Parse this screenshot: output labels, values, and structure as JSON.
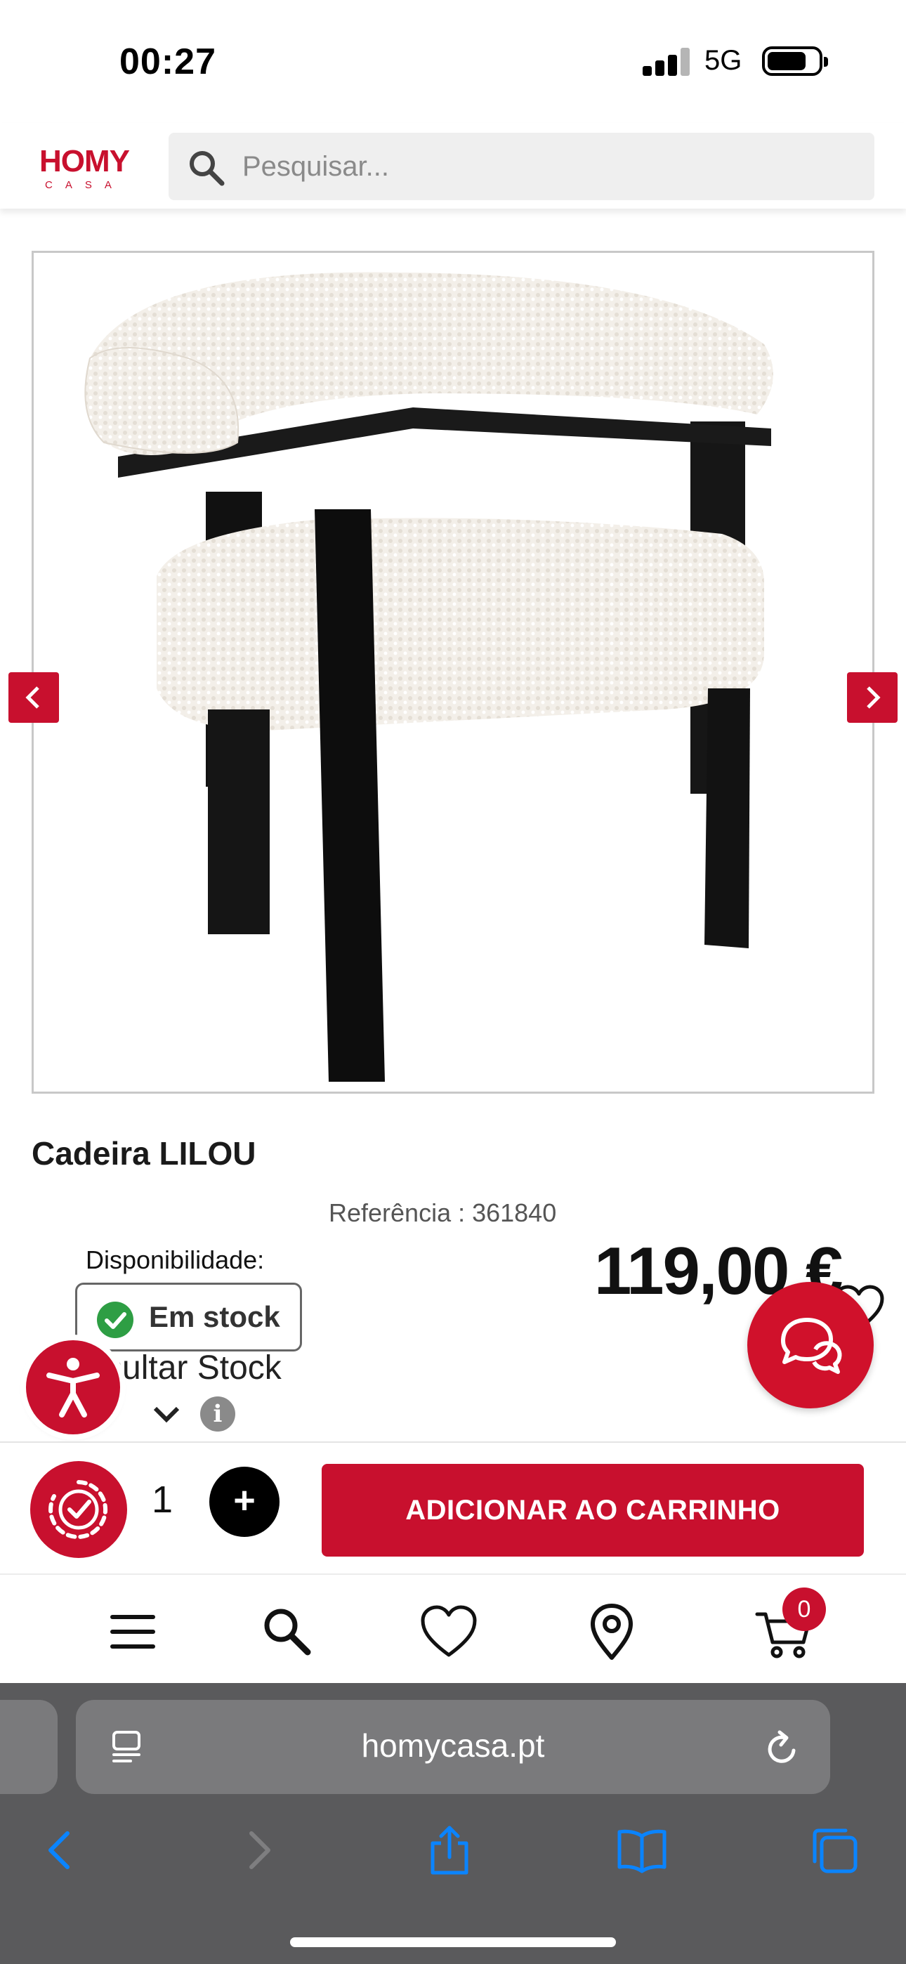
{
  "status_bar": {
    "time": "00:27",
    "network": "5G"
  },
  "header": {
    "logo_main": "HOMY",
    "logo_sub": "CASA",
    "search_placeholder": "Pesquisar..."
  },
  "product": {
    "title": "Cadeira LILOU",
    "reference": "Referência : 361840",
    "availability_label": "Disponibilidade:",
    "stock_status": "Em stock",
    "price": "119,00 €",
    "stock_link": "sultar Stock"
  },
  "cart_bar": {
    "quantity": "1",
    "plus_label": "+",
    "add_to_cart_label": "ADICIONAR AO CARRINHO"
  },
  "bottom_nav": {
    "items": [
      "menu-icon",
      "search-icon",
      "heart-icon",
      "location-pin-icon",
      "cart-icon"
    ],
    "cart_count": "0"
  },
  "browser": {
    "url": "homycasa.pt"
  },
  "colors": {
    "brand_red": "#c8102e",
    "stock_green": "#2e9e44",
    "safari_blue": "#0a84ff",
    "safari_bar": "#5a5a5c"
  },
  "info_glyph": "i"
}
